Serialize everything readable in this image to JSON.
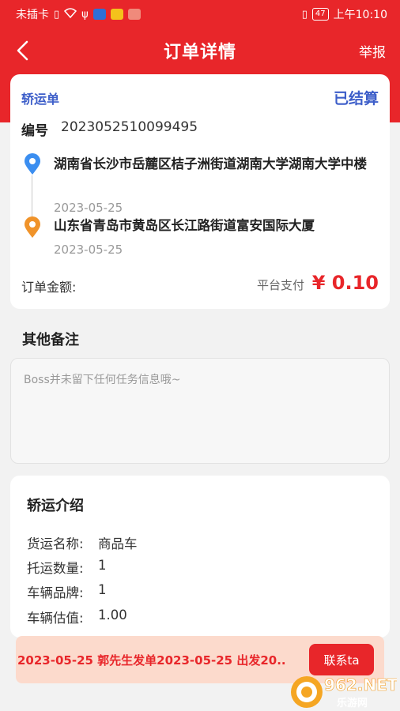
{
  "status_bar": {
    "carrier": "未插卡",
    "battery": "47",
    "time": "上午10:10"
  },
  "nav": {
    "title": "订单详情",
    "report": "举报"
  },
  "order": {
    "type": "轿运单",
    "status": "已结算",
    "number_label": "编号",
    "number": "2023052510099495",
    "from_address": "湖南省长沙市岳麓区桔子洲街道湖南大学湖南大学中楼",
    "from_date": "2023-05-25",
    "to_address": "山东省青岛市黄岛区长江路街道富安国际大厦",
    "to_date": "2023-05-25",
    "amount_label": "订单金额:",
    "pay_method": "平台支付",
    "amount": "¥ 0.10"
  },
  "remark": {
    "title": "其他备注",
    "text": "Boss并未留下任何任务信息哦~"
  },
  "intro": {
    "title": "轿运介绍",
    "rows": [
      {
        "key": "货运名称:",
        "value": "商品车"
      },
      {
        "key": "托运数量:",
        "value": "1"
      },
      {
        "key": "车辆品牌:",
        "value": "1"
      },
      {
        "key": "车辆估值:",
        "value": "1.00"
      }
    ]
  },
  "bottom": {
    "text": "2023-05-25 郭先生发单2023-05-25 出发20..",
    "contact": "联系ta"
  },
  "watermark": {
    "brand": "962.NET",
    "sub": "乐游网"
  },
  "colors": {
    "brand_red": "#e8262a",
    "accent_blue": "#3d5ec9",
    "pin_blue": "#3b8ef0",
    "pin_orange": "#f0932a"
  }
}
